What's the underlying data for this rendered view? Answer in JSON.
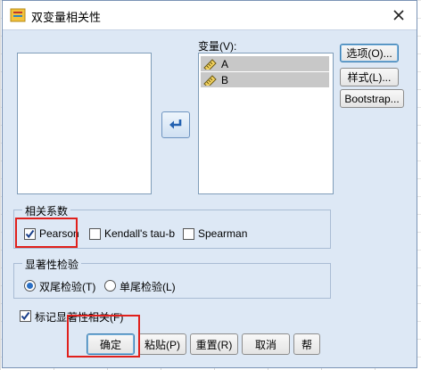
{
  "dialog": {
    "title": "双变量相关性"
  },
  "variables": {
    "label": "变量(V):",
    "items": [
      "A",
      "B"
    ]
  },
  "side_buttons": {
    "options": "选项(O)...",
    "style": "样式(L)...",
    "bootstrap": "Bootstrap..."
  },
  "correlation": {
    "group_label": "相关系数",
    "pearson": "Pearson",
    "pearson_checked": true,
    "kendall": "Kendall's tau-b",
    "kendall_checked": false,
    "spearman": "Spearman",
    "spearman_checked": false
  },
  "significance": {
    "group_label": "显著性检验",
    "two_tailed": "双尾检验(T)",
    "one_tailed": "单尾检验(L)",
    "selected": "two_tailed"
  },
  "flag": {
    "label": "标记显著性相关(F)",
    "checked": true
  },
  "footer_buttons": {
    "ok": "确定",
    "paste": "粘贴(P)",
    "reset": "重置(R)",
    "cancel": "取消",
    "help": "帮"
  },
  "colors": {
    "accent": "#2a6fc4",
    "highlight": "#e0201c",
    "dialog_bg": "#dde8f5"
  }
}
